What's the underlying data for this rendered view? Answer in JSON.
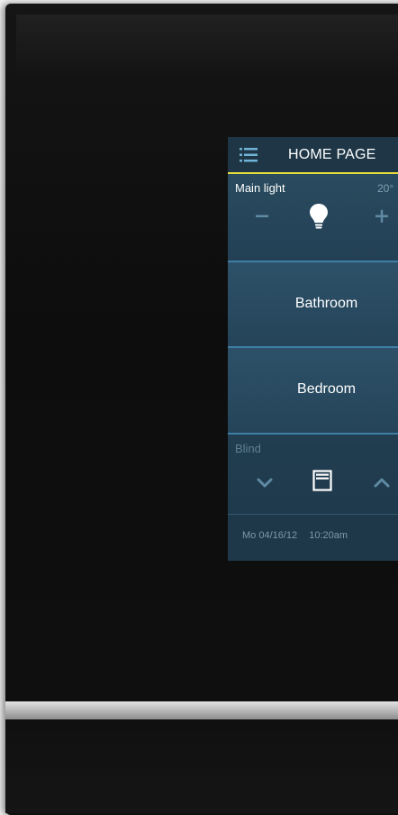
{
  "header": {
    "title": "HOME PAGE"
  },
  "main_light": {
    "label": "Main light",
    "value": "20°"
  },
  "rooms": [
    {
      "label": "Bathroom"
    },
    {
      "label": "Bedroom"
    }
  ],
  "blind": {
    "label": "Blind"
  },
  "status": {
    "date": "Mo 04/16/12",
    "time": "10:20am"
  },
  "colors": {
    "screen_bg": "#284a5d",
    "header_underline": "#e6dc3c",
    "divider_blue": "#3f7fa6",
    "device_bezel": "#101010"
  },
  "icons": [
    "menu-icon",
    "minus-icon",
    "light-bulb-icon",
    "plus-icon",
    "chevron-down-icon",
    "blind-stop-icon",
    "chevron-up-icon"
  ]
}
